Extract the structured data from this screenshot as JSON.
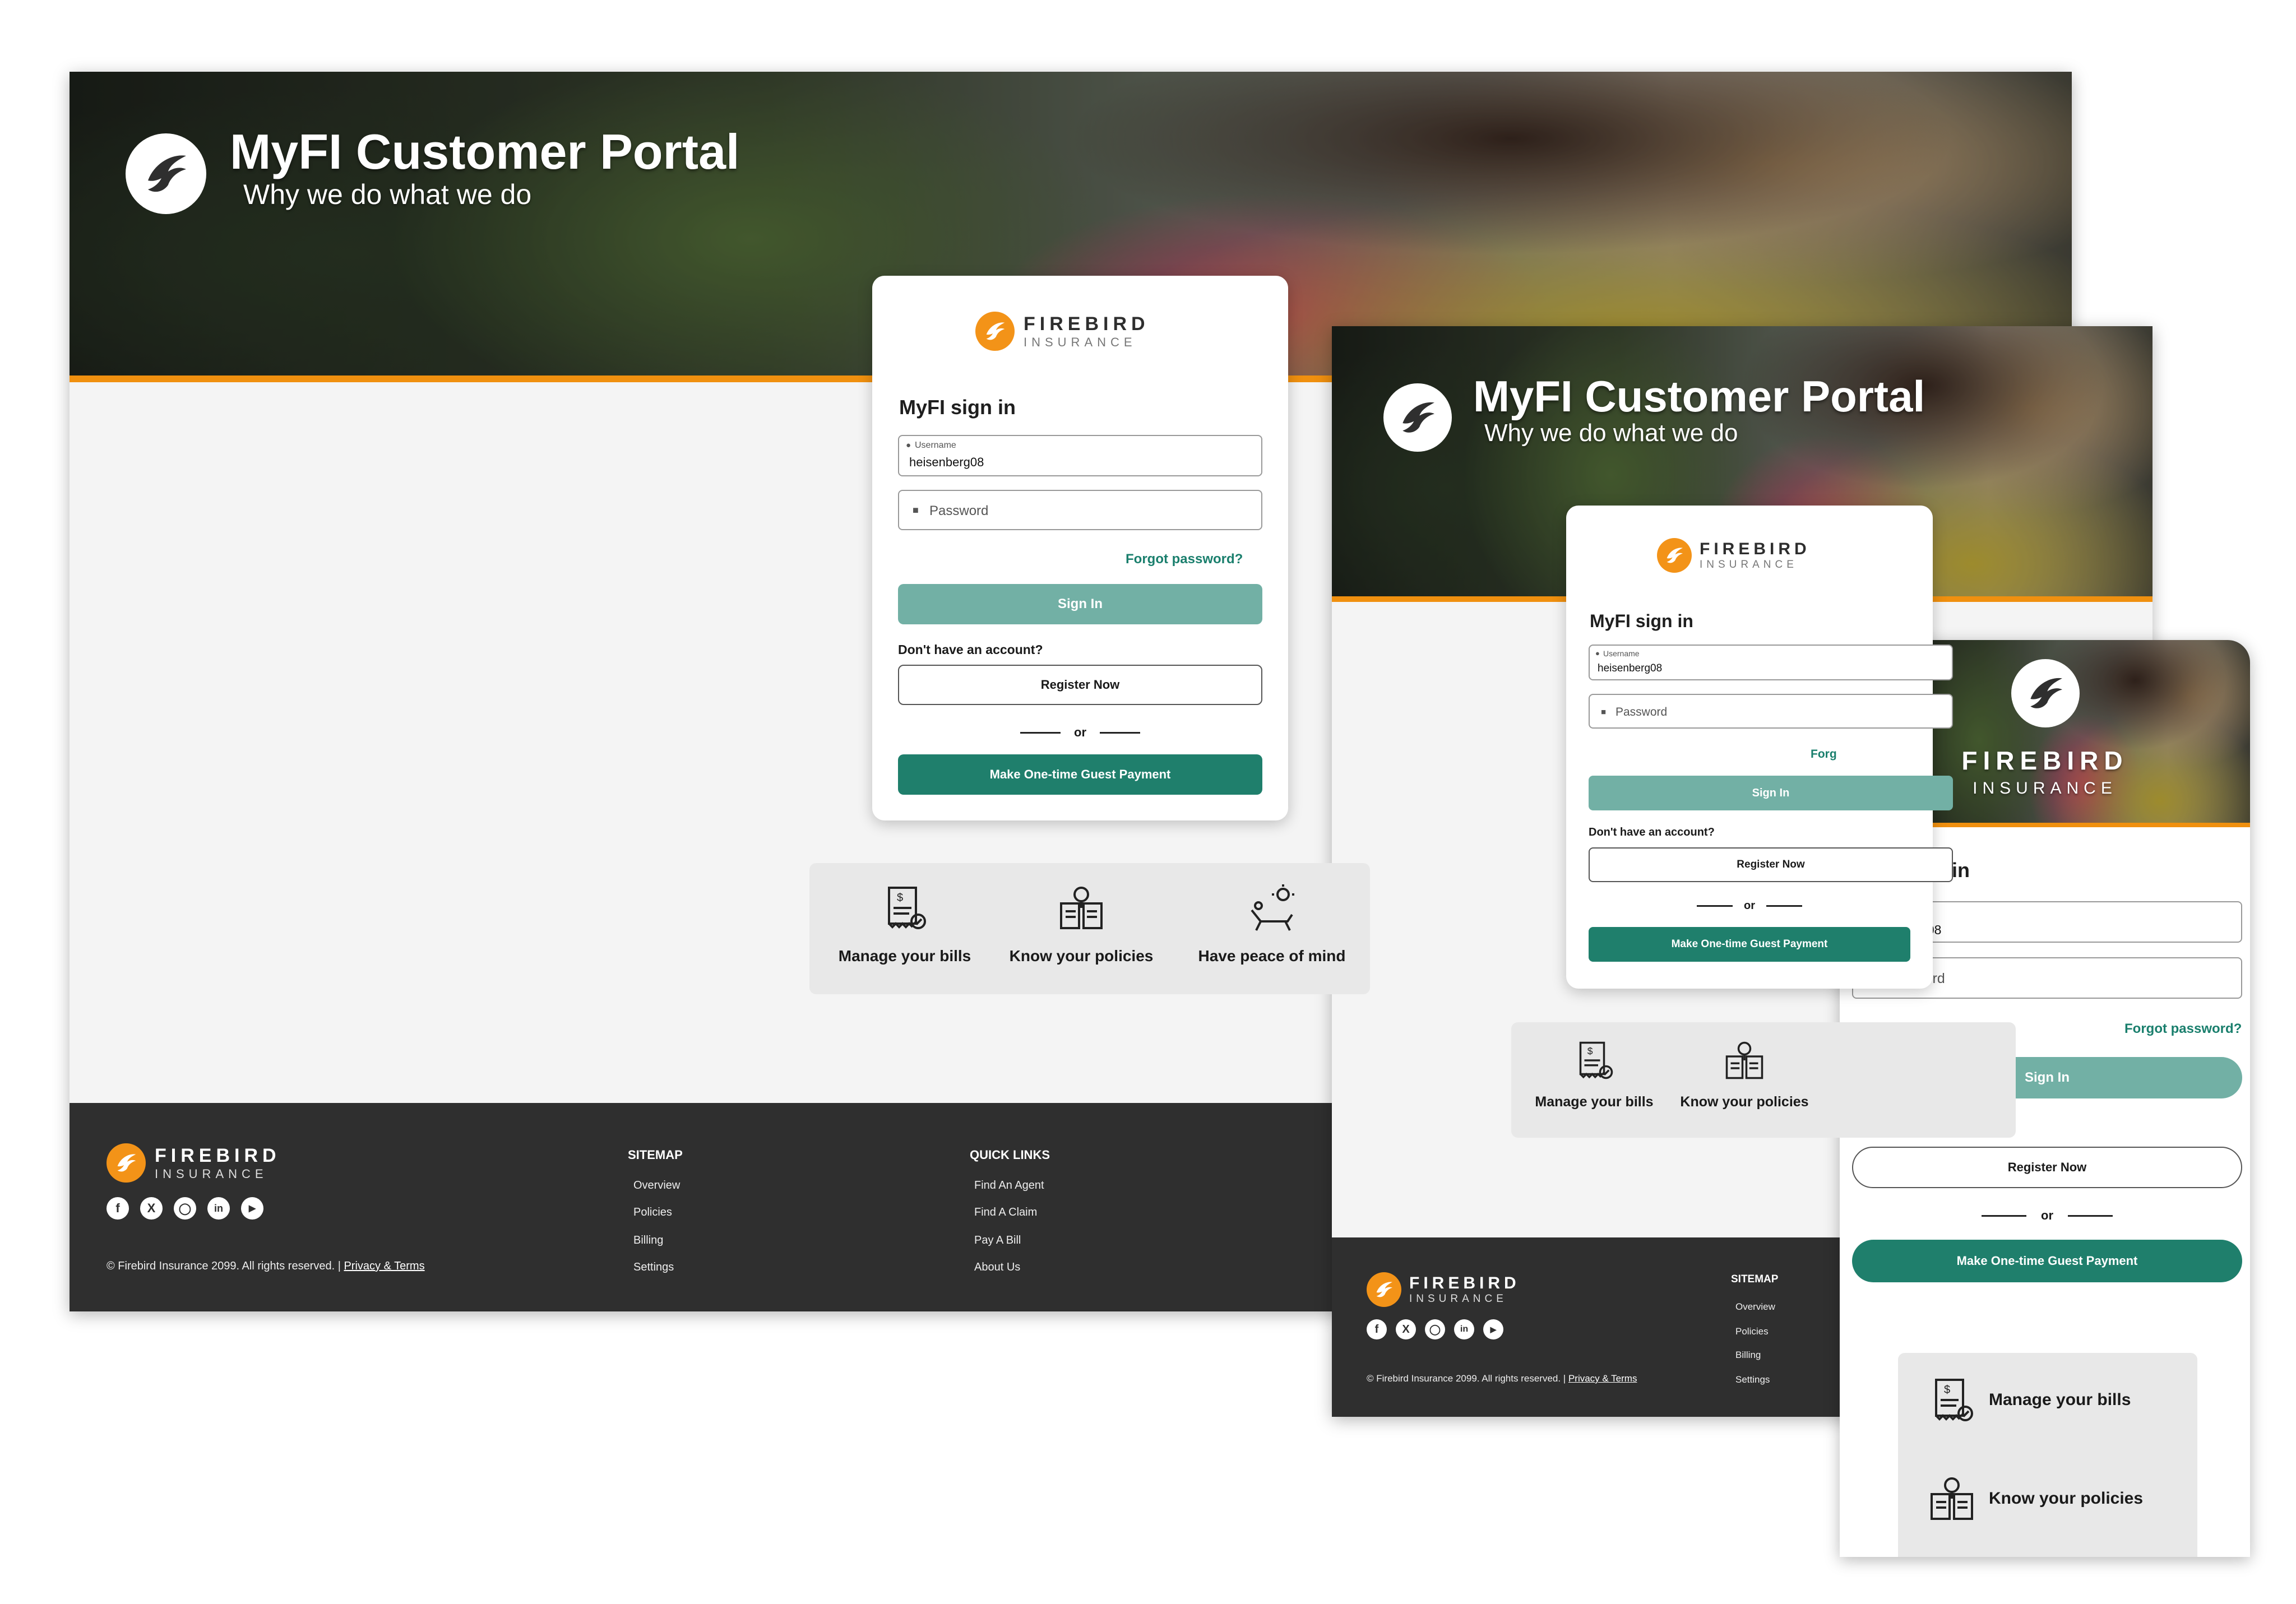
{
  "portal": {
    "title": "MyFI Customer Portal",
    "subtitle": "Why we do what we do"
  },
  "brand": {
    "name": "FIREBIRD",
    "sub": "INSURANCE",
    "accent": "#f39318",
    "teal": "#1f7f6c",
    "teal_light": "#72b0a5",
    "footer_bg": "#2f2f2f"
  },
  "signin": {
    "title": "MyFI sign in",
    "username_label": "Username",
    "username_value": "heisenberg08",
    "password_placeholder": "Password",
    "forgot": "Forgot password?",
    "forgot_cut": "Forg",
    "signin_button": "Sign In",
    "no_account": "Don't have an account?",
    "register_button": "Register Now",
    "or": "or",
    "guest_button": "Make One-time Guest Payment"
  },
  "features": [
    {
      "label": "Manage your bills",
      "icon": "bill-icon"
    },
    {
      "label": "Know your policies",
      "icon": "policy-book-icon"
    },
    {
      "label": "Have peace of mind",
      "icon": "lounge-chair-icon"
    }
  ],
  "footer": {
    "sitemap_title": "SITEMAP",
    "sitemap": [
      "Overview",
      "Policies",
      "Billing",
      "Settings"
    ],
    "quicklinks_title": "QUICK LINKS",
    "quicklinks": [
      "Find An Agent",
      "Find A Claim",
      "Pay A Bill",
      "About Us"
    ],
    "copyright": "© Firebird Insurance 2099. All rights reserved. |",
    "privacy": "Privacy & Terms",
    "social": [
      "facebook-icon",
      "x-icon",
      "instagram-icon",
      "linkedin-icon",
      "youtube-icon"
    ]
  }
}
